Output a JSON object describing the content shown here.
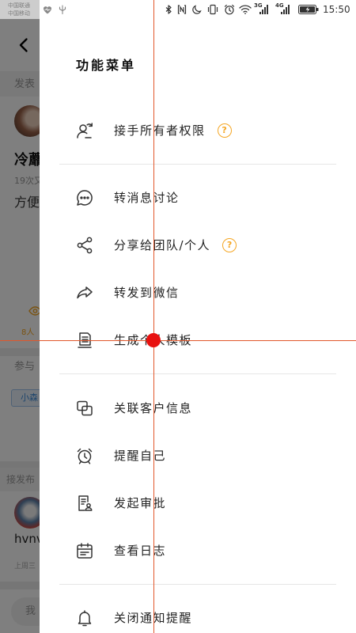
{
  "status_bar": {
    "carrier_1": "中国联通",
    "carrier_2": "中国移动",
    "left_icons": [
      "heart-icon",
      "usb-icon"
    ],
    "right_icons": [
      "bluetooth-icon",
      "nfc-icon",
      "moon-icon",
      "vibrate-icon",
      "alarm-icon",
      "wifi-icon",
      "signal-icon",
      "signal-icon",
      "battery-icon"
    ],
    "signal_1_label": "3G",
    "signal_2_label": "4G",
    "battery_level": 1.0,
    "time": "15:50"
  },
  "background_app": {
    "back_icon": "back-arrow-icon",
    "section_label": "发表",
    "post": {
      "author": "冷蘼",
      "meta": "19次又",
      "content": "方便",
      "views_icon": "eye-icon",
      "views": "8人"
    },
    "participants_label": "参与",
    "participant_chip": "小森",
    "replies_label": "接发布",
    "reply": {
      "author": "hvnv",
      "time": "上周三"
    },
    "input_text": "我"
  },
  "menu": {
    "title": "功能菜单",
    "help_glyph": "?",
    "groups": [
      {
        "items": [
          {
            "label": "接手所有者权限",
            "icon": "take-over-owner-icon",
            "has_help": true
          }
        ]
      },
      {
        "items": [
          {
            "label": "转消息讨论",
            "icon": "chat-bubble-icon"
          },
          {
            "label": "分享给团队/个人",
            "icon": "share-icon",
            "has_help": true
          },
          {
            "label": "转发到微信",
            "icon": "forward-icon"
          },
          {
            "label": "生成个人模板",
            "icon": "template-document-icon"
          }
        ]
      },
      {
        "items": [
          {
            "label": "关联客户信息",
            "icon": "link-icon"
          },
          {
            "label": "提醒自己",
            "icon": "alarm-clock-icon"
          },
          {
            "label": "发起审批",
            "icon": "approval-icon"
          },
          {
            "label": "查看日志",
            "icon": "calendar-icon"
          }
        ]
      },
      {
        "items": [
          {
            "label": "关闭通知提醒",
            "icon": "bell-icon"
          }
        ]
      }
    ]
  },
  "colors": {
    "accent_orange": "#f5a623",
    "text_primary": "#222222",
    "divider": "#e6e6e6",
    "chip_blue": "#3d8bd9",
    "pointer_line": "#e2572b",
    "pointer_dot": "#e8110f",
    "scrim": "rgba(0,0,0,0.5)"
  }
}
